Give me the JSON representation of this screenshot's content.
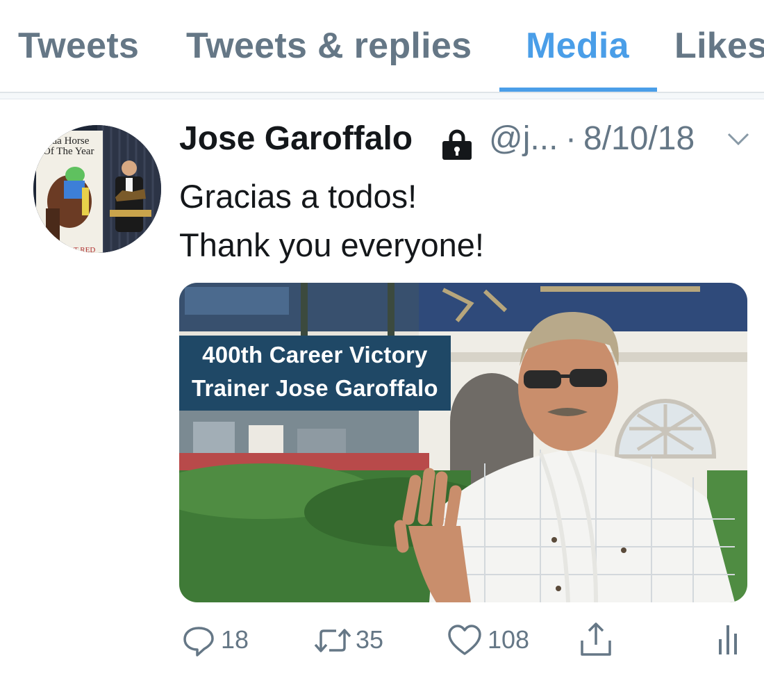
{
  "tabs": [
    {
      "label": "Tweets",
      "active": false
    },
    {
      "label": "Tweets & replies",
      "active": false
    },
    {
      "label": "Media",
      "active": true
    },
    {
      "label": "Likes",
      "active": false
    }
  ],
  "tweet": {
    "author_name": "Jose Garoffalo",
    "handle": "@j...",
    "separator": "·",
    "date": "8/10/18",
    "protected_icon": "lock-icon",
    "text_lines": [
      "Gracias a todos!",
      "Thank you everyone!"
    ],
    "avatar": {
      "plaque_line1": "orida Horse",
      "plaque_line2": "Of The Year",
      "footer_text": "T RED"
    },
    "media": {
      "caption_line1": "400th Career Victory",
      "caption_line2": "Trainer Jose Garoffalo"
    },
    "actions": {
      "reply_count": "18",
      "retweet_count": "35",
      "like_count": "108"
    }
  },
  "colors": {
    "accent": "#4a9ee8",
    "secondary_text": "#657786",
    "primary_text": "#14171a",
    "caption_bg": "#1f4866"
  }
}
